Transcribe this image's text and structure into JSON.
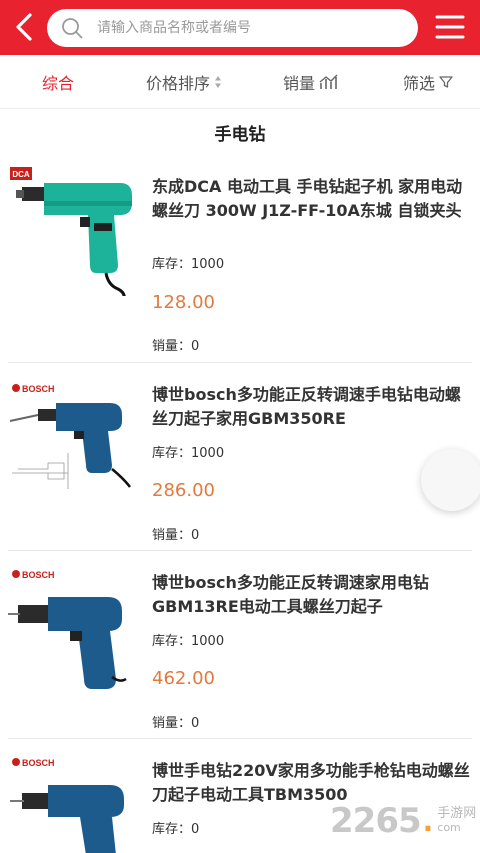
{
  "header": {
    "search_placeholder": "请输入商品名称或者编号"
  },
  "sortbar": {
    "tabs": [
      {
        "label": "综合",
        "active": true
      },
      {
        "label": "价格排序"
      },
      {
        "label": "销量"
      },
      {
        "label": "筛选"
      }
    ]
  },
  "category_title": "手电钻",
  "colors": {
    "brand": "#e8232f",
    "price": "#e07a40"
  },
  "products": [
    {
      "name": "东成DCA 电动工具 手电钻起子机 家用电动螺丝刀 300W J1Z-FF-10A东城 自锁夹头",
      "stock": "库存：1000",
      "price": "128.00",
      "sold": "销量：0",
      "image": "dca-drill-image",
      "brand_text": "DCA"
    },
    {
      "name": "博世bosch多功能正反转调速手电钻电动螺丝刀起子家用GBM350RE",
      "stock": "库存：1000",
      "price": "286.00",
      "sold": "销量：0",
      "image": "bosch-drill-image",
      "brand_text": "BOSCH"
    },
    {
      "name": "博世bosch多功能正反转调速家用电钻GBM13RE电动工具螺丝刀起子",
      "stock": "库存：1000",
      "price": "462.00",
      "sold": "销量：0",
      "image": "bosch-drill-image",
      "brand_text": "BOSCH"
    },
    {
      "name": "博世手电钻220V家用多功能手枪钻电动螺丝刀起子电动工具TBM3500",
      "stock": "库存：0",
      "image": "bosch-drill-image",
      "brand_text": "BOSCH"
    }
  ],
  "watermark": {
    "number": "2265",
    "dot": ".",
    "site": "手游网",
    "domain": "com"
  }
}
